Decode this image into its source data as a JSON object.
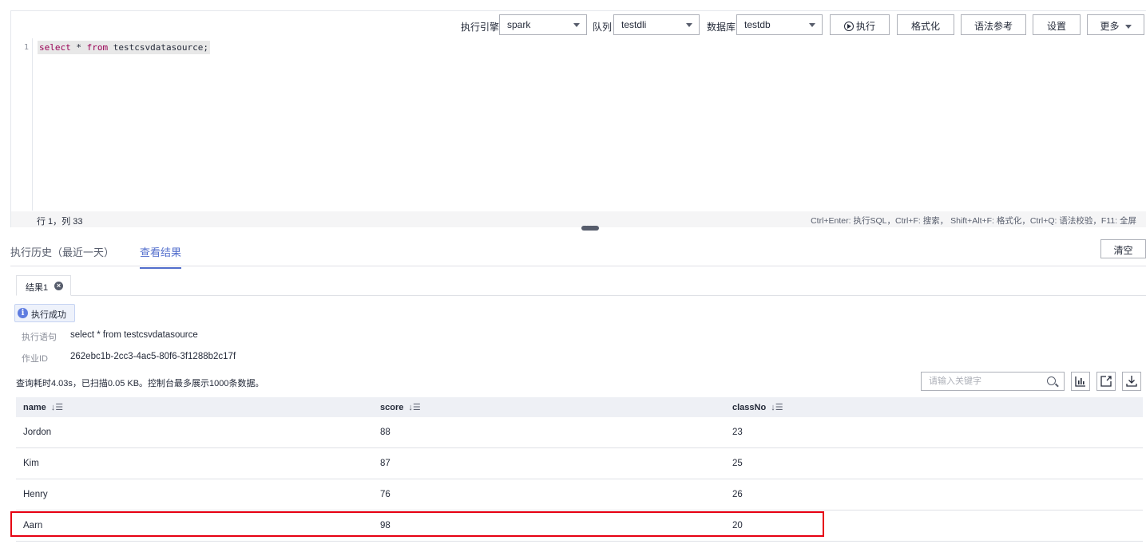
{
  "toolbar": {
    "engine_label": "执行引擎",
    "engine_value": "spark",
    "queue_label": "队列",
    "queue_value": "testdli",
    "database_label": "数据库",
    "database_value": "testdb",
    "run_label": "执行",
    "format_label": "格式化",
    "syntax_ref_label": "语法参考",
    "settings_label": "设置",
    "more_label": "更多"
  },
  "editor": {
    "line_number": "1",
    "kw_select": "select",
    "code_mid": " * ",
    "kw_from": "from",
    "code_rest": " testcsvdatasource;",
    "cursor_position": "行 1，列 33",
    "shortcuts_hint": "Ctrl+Enter: 执行SQL，Ctrl+F: 搜索， Shift+Alt+F: 格式化，Ctrl+Q: 语法校验，F11: 全屏"
  },
  "tabs": {
    "history_label": "执行历史（最近一天）",
    "results_label": "查看结果",
    "clear_label": "清空"
  },
  "result": {
    "tab_label": "结果1",
    "status_text": "执行成功",
    "statement_label": "执行语句",
    "statement_value": "select * from testcsvdatasource",
    "job_id_label": "作业ID",
    "job_id_value": "262ebc1b-2cc3-4ac5-80f6-3f1288b2c17f",
    "summary": "查询耗时4.03s，已扫描0.05 KB。控制台最多展示1000条数据。",
    "search_placeholder": "请输入关键字"
  },
  "table": {
    "columns": [
      "name",
      "score",
      "classNo"
    ],
    "rows": [
      [
        "Jordon",
        "88",
        "23"
      ],
      [
        "Kim",
        "87",
        "25"
      ],
      [
        "Henry",
        "76",
        "26"
      ],
      [
        "Aarn",
        "98",
        "20"
      ]
    ]
  },
  "icons": {
    "run": "play-circle-icon",
    "close": "close-circle-icon",
    "info": "info-icon",
    "search": "search-icon",
    "chart": "bar-chart-icon",
    "export": "export-icon",
    "download": "download-icon",
    "sort": "sort-icon"
  },
  "colors": {
    "accent": "#526ecc",
    "highlight": "#e60012",
    "keyword": "#990055"
  }
}
